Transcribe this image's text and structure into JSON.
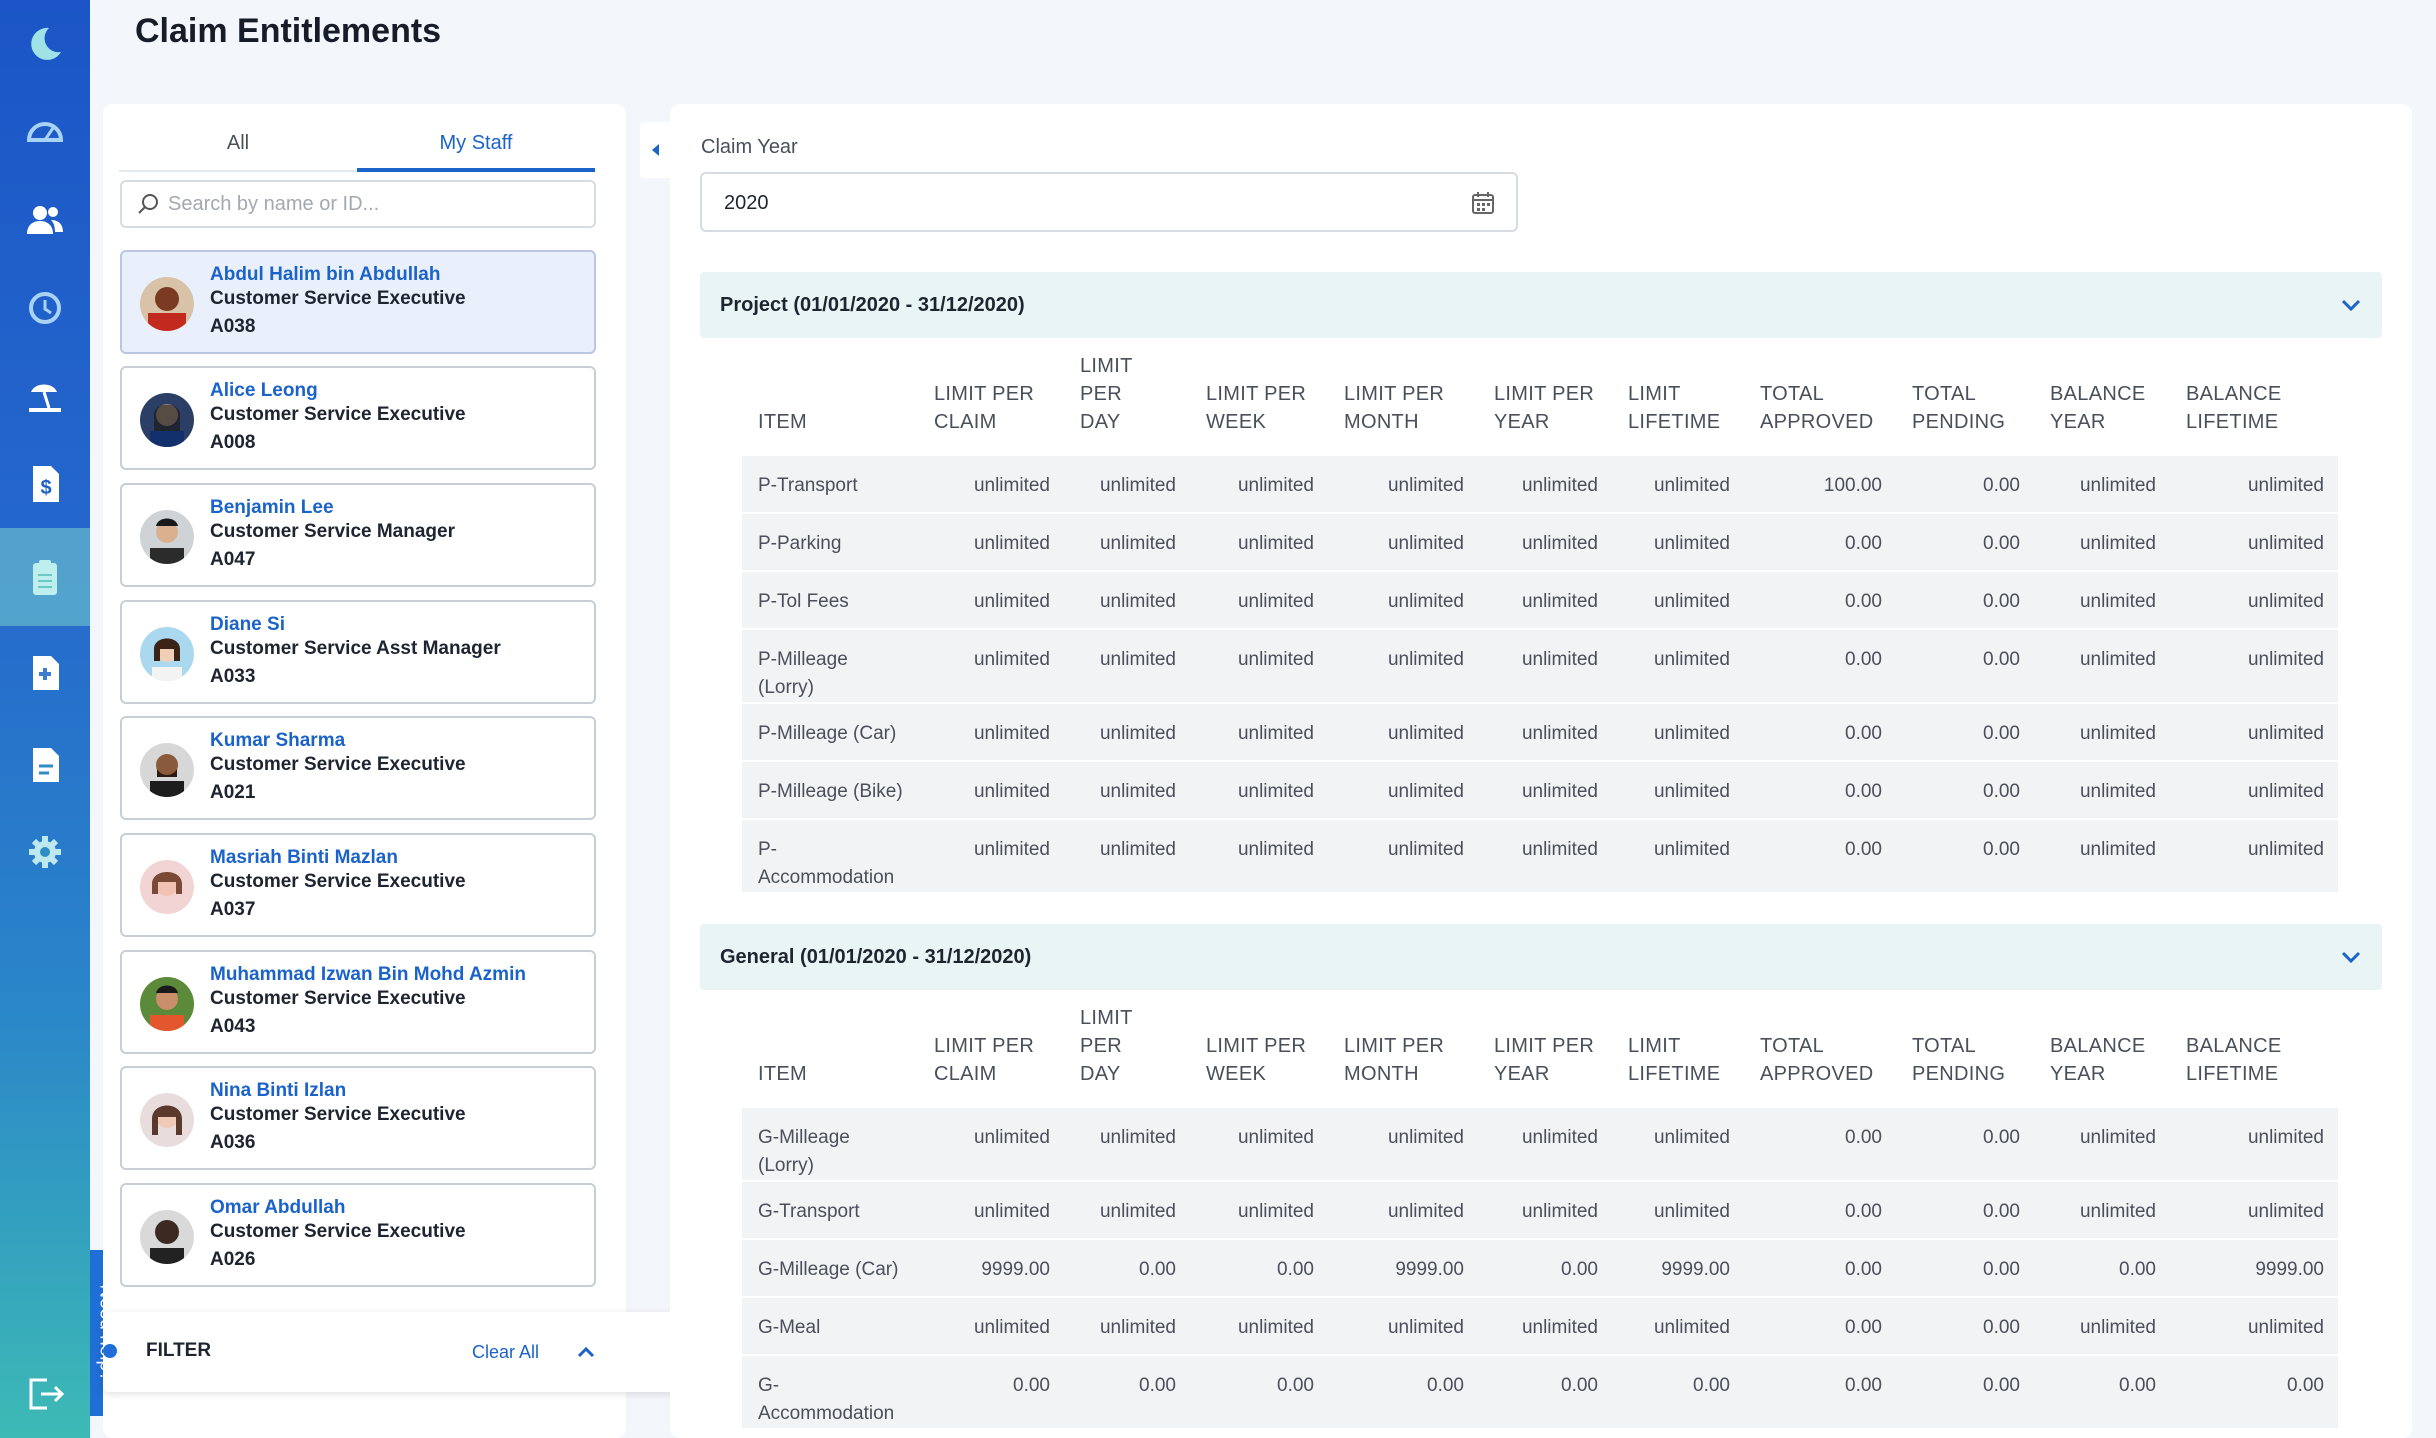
{
  "page": {
    "title": "Claim Entitlements",
    "need_help": "Need help?"
  },
  "sidebar": {
    "items": [
      {
        "icon": "moon-logo-icon"
      },
      {
        "icon": "dashboard-gauge-icon"
      },
      {
        "icon": "people-icon"
      },
      {
        "icon": "history-clock-icon"
      },
      {
        "icon": "leave-beach-icon"
      },
      {
        "icon": "dollar-document-icon"
      },
      {
        "icon": "clipboard-icon",
        "active": true
      },
      {
        "icon": "medical-document-icon"
      },
      {
        "icon": "report-document-icon"
      },
      {
        "icon": "gear-icon"
      },
      {
        "icon": "logout-icon"
      }
    ]
  },
  "left": {
    "tabs": [
      {
        "label": "All"
      },
      {
        "label": "My Staff",
        "active": true
      }
    ],
    "search_placeholder": "Search by name or ID...",
    "staff": [
      {
        "name": "Abdul Halim bin Abdullah",
        "role": "Customer Service Executive",
        "id": "A038",
        "selected": true
      },
      {
        "name": "Alice Leong",
        "role": "Customer Service Executive",
        "id": "A008"
      },
      {
        "name": "Benjamin Lee",
        "role": "Customer Service Manager",
        "id": "A047"
      },
      {
        "name": "Diane Si",
        "role": "Customer Service Asst Manager",
        "id": "A033"
      },
      {
        "name": "Kumar Sharma",
        "role": "Customer Service Executive",
        "id": "A021"
      },
      {
        "name": "Masriah Binti Mazlan",
        "role": "Customer Service Executive",
        "id": "A037"
      },
      {
        "name": "Muhammad Izwan Bin Mohd Azmin",
        "role": "Customer Service Executive",
        "id": "A043"
      },
      {
        "name": "Nina Binti Izlan",
        "role": "Customer Service Executive",
        "id": "A036"
      },
      {
        "name": "Omar Abdullah",
        "role": "Customer Service Executive",
        "id": "A026"
      }
    ],
    "filter": {
      "label": "FILTER",
      "clear_all": "Clear All"
    }
  },
  "right": {
    "claim_year_label": "Claim Year",
    "claim_year_value": "2020",
    "columns": [
      [
        "ITEM"
      ],
      [
        "LIMIT PER",
        "CLAIM"
      ],
      [
        "LIMIT PER",
        "DAY"
      ],
      [
        "LIMIT PER",
        "WEEK"
      ],
      [
        "LIMIT PER",
        "MONTH"
      ],
      [
        "LIMIT PER",
        "YEAR"
      ],
      [
        "LIMIT",
        "LIFETIME"
      ],
      [
        "TOTAL",
        "APPROVED"
      ],
      [
        "TOTAL",
        "PENDING"
      ],
      [
        "BALANCE",
        "YEAR"
      ],
      [
        "BALANCE",
        "LIFETIME"
      ]
    ],
    "sections": [
      {
        "title": "Project (01/01/2020 - 31/12/2020)",
        "rows": [
          [
            "P-Transport",
            "unlimited",
            "unlimited",
            "unlimited",
            "unlimited",
            "unlimited",
            "unlimited",
            "100.00",
            "0.00",
            "unlimited",
            "unlimited"
          ],
          [
            "P-Parking",
            "unlimited",
            "unlimited",
            "unlimited",
            "unlimited",
            "unlimited",
            "unlimited",
            "0.00",
            "0.00",
            "unlimited",
            "unlimited"
          ],
          [
            "P-Tol Fees",
            "unlimited",
            "unlimited",
            "unlimited",
            "unlimited",
            "unlimited",
            "unlimited",
            "0.00",
            "0.00",
            "unlimited",
            "unlimited"
          ],
          [
            "P-Milleage (Lorry)",
            "unlimited",
            "unlimited",
            "unlimited",
            "unlimited",
            "unlimited",
            "unlimited",
            "0.00",
            "0.00",
            "unlimited",
            "unlimited"
          ],
          [
            "P-Milleage (Car)",
            "unlimited",
            "unlimited",
            "unlimited",
            "unlimited",
            "unlimited",
            "unlimited",
            "0.00",
            "0.00",
            "unlimited",
            "unlimited"
          ],
          [
            "P-Milleage (Bike)",
            "unlimited",
            "unlimited",
            "unlimited",
            "unlimited",
            "unlimited",
            "unlimited",
            "0.00",
            "0.00",
            "unlimited",
            "unlimited"
          ],
          [
            "P-Accommodation",
            "unlimited",
            "unlimited",
            "unlimited",
            "unlimited",
            "unlimited",
            "unlimited",
            "0.00",
            "0.00",
            "unlimited",
            "unlimited"
          ]
        ]
      },
      {
        "title": "General (01/01/2020 - 31/12/2020)",
        "rows": [
          [
            "G-Milleage (Lorry)",
            "unlimited",
            "unlimited",
            "unlimited",
            "unlimited",
            "unlimited",
            "unlimited",
            "0.00",
            "0.00",
            "unlimited",
            "unlimited"
          ],
          [
            "G-Transport",
            "unlimited",
            "unlimited",
            "unlimited",
            "unlimited",
            "unlimited",
            "unlimited",
            "0.00",
            "0.00",
            "unlimited",
            "unlimited"
          ],
          [
            "G-Milleage (Car)",
            "9999.00",
            "0.00",
            "0.00",
            "9999.00",
            "0.00",
            "9999.00",
            "0.00",
            "0.00",
            "0.00",
            "9999.00"
          ],
          [
            "G-Meal",
            "unlimited",
            "unlimited",
            "unlimited",
            "unlimited",
            "unlimited",
            "unlimited",
            "0.00",
            "0.00",
            "unlimited",
            "unlimited"
          ],
          [
            "G-Accommodation",
            "0.00",
            "0.00",
            "0.00",
            "0.00",
            "0.00",
            "0.00",
            "0.00",
            "0.00",
            "0.00",
            "0.00"
          ]
        ]
      }
    ]
  },
  "colors": {
    "primary": "#1b63c9",
    "section_bg": "#e9f5f5",
    "row_bg": "#f2f3f5"
  }
}
